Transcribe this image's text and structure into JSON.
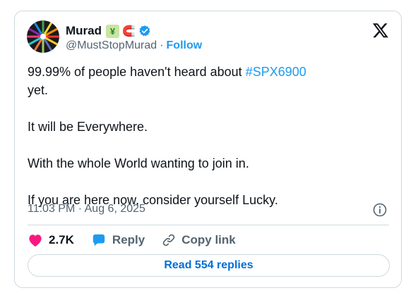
{
  "tweet": {
    "author": {
      "name": "Murad",
      "handle": "@MustStopMurad",
      "follow_label": "Follow",
      "separator": "·",
      "badge_emoji_char": "¥",
      "magnet_emoji": "🧲"
    },
    "text_before_tag": "99.99% of people haven't heard about ",
    "hashtag": "#SPX6900",
    "text_after_tag": "\nyet.\n\nIt will be Everywhere.\n\nWith the whole World wanting to join in.\n\nIf you are here now, consider yourself Lucky.",
    "timestamp": "11:03 PM · Aug 6, 2025",
    "likes": "2.7K",
    "reply_label": "Reply",
    "copy_link_label": "Copy link",
    "read_replies_label": "Read 554 replies"
  },
  "colors": {
    "accent": "#1d9bf0",
    "heart": "#f91880",
    "verified": "#1d9bf0",
    "read_link": "#006fd6"
  }
}
